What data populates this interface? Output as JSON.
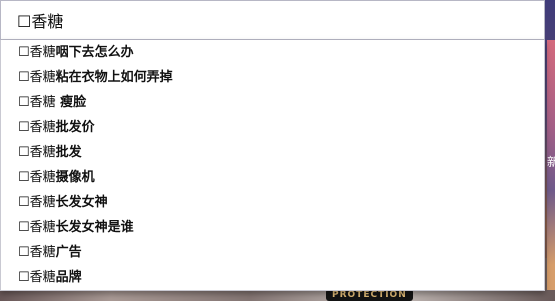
{
  "search": {
    "query": "☐香糖"
  },
  "suggestions": [
    {
      "prefix": "☐香糖",
      "rest": "咽下去怎么办"
    },
    {
      "prefix": "☐香糖",
      "rest": "粘在衣物上如何弄掉"
    },
    {
      "prefix": "☐香糖",
      "rest": " 瘦脸"
    },
    {
      "prefix": "☐香糖",
      "rest": "批发价"
    },
    {
      "prefix": "☐香糖",
      "rest": "批发"
    },
    {
      "prefix": "☐香糖",
      "rest": "摄像机"
    },
    {
      "prefix": "☐香糖",
      "rest": "长发女神"
    },
    {
      "prefix": "☐香糖",
      "rest": "长发女神是谁"
    },
    {
      "prefix": "☐香糖",
      "rest": "广告"
    },
    {
      "prefix": "☐香糖",
      "rest": "品牌"
    }
  ],
  "background": {
    "edge_text": "新",
    "badge_text": "PROTECTION"
  }
}
